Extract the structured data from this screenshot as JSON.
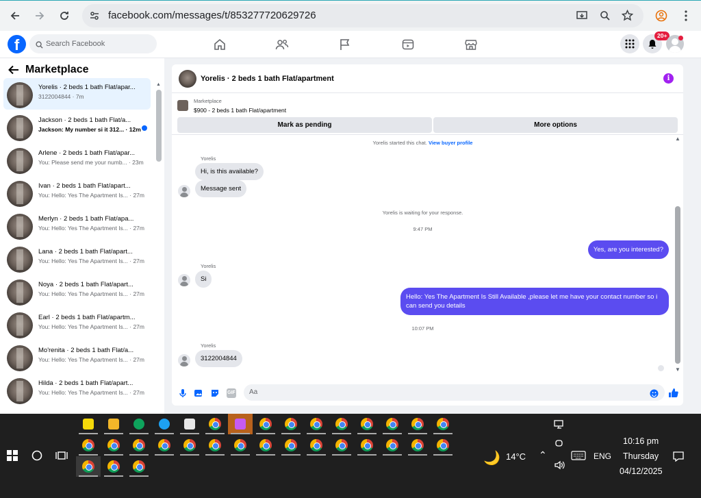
{
  "browser": {
    "url": "facebook.com/messages/t/853277720629726"
  },
  "fb": {
    "search_placeholder": "Search Facebook",
    "notif_badge": "20+"
  },
  "sidebar": {
    "title": "Marketplace",
    "conversations": [
      {
        "title": "Yorelis · 2 beds 1 bath Flat/apar...",
        "snippet": "3122004844 · 7m",
        "selected": true
      },
      {
        "title": "Jackson · 2 beds 1 bath Flat/a...",
        "snippet": "Jackson: My number si it 312... · 12m",
        "unread": true
      },
      {
        "title": "Arlene · 2 beds 1 bath Flat/apar...",
        "snippet": "You: Please send me your numb... · 23m"
      },
      {
        "title": "Ivan · 2 beds 1 bath Flat/apart...",
        "snippet": "You: Hello: Yes The Apartment Is... · 27m"
      },
      {
        "title": "Merlyn · 2 beds 1 bath Flat/apa...",
        "snippet": "You: Hello: Yes The Apartment Is... · 27m"
      },
      {
        "title": "Lana · 2 beds 1 bath Flat/apart...",
        "snippet": "You: Hello: Yes The Apartment Is... · 27m"
      },
      {
        "title": "Noya · 2 beds 1 bath Flat/apart...",
        "snippet": "You: Hello: Yes The Apartment Is... · 27m"
      },
      {
        "title": "Earl · 2 beds 1 bath Flat/apartm...",
        "snippet": "You: Hello: Yes The Apartment Is... · 27m"
      },
      {
        "title": "Mo'renita · 2 beds 1 bath Flat/a...",
        "snippet": "You: Hello: Yes The Apartment Is... · 27m"
      },
      {
        "title": "Hilda · 2 beds 1 bath Flat/apart...",
        "snippet": "You: Hello: Yes The Apartment Is... · 27m"
      }
    ]
  },
  "chat": {
    "header": "Yorelis · 2 beds 1 bath Flat/apartment",
    "listing_label": "Marketplace",
    "listing_price": "$900 - 2 beds 1 bath Flat/apartment",
    "mark_pending": "Mark as pending",
    "more_options": "More options",
    "started": "Yorelis started this chat.",
    "view_profile": "View buyer profile",
    "sender": "Yorelis",
    "msg1": "Hi, is this available?",
    "msg2": "Message sent",
    "waiting": "Yorelis is waiting for your response.",
    "time1": "9:47 PM",
    "out1": "Yes, are you interested?",
    "msg3": "Si",
    "out2": "Hello: Yes The Apartment Is Still Available ,please let me have your contact number so i can send you details",
    "time2": "10:07 PM",
    "msg4": "3122004844",
    "composer_placeholder": "Aa"
  },
  "taskbar": {
    "temp": "14°C",
    "lang": "ENG",
    "time": "10:16 pm",
    "day": "Thursday",
    "date": "04/12/2025"
  }
}
